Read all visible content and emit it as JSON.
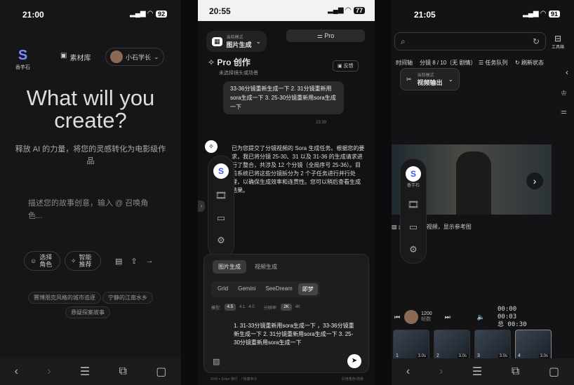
{
  "phone1": {
    "time": "21:00",
    "battery": "92",
    "logo_text": "香芋石",
    "library": "素材库",
    "user": "小石学长",
    "headline": "What will you create?",
    "tagline": "释放 AI 的力量，将您的灵感转化为电影级作品",
    "prompt_placeholder": "描述您的故事创意，输入 @ 召唤角色...",
    "role_btn": "选择角色",
    "smart_btn": "智能推荐",
    "chips": [
      "赛博朋克风格的城市追逐",
      "宁静的江南水乡",
      "悬疑探案故事"
    ]
  },
  "phone2": {
    "time": "20:55",
    "battery": "77",
    "mode_label": "当前模式",
    "mode_value": "图片生成",
    "pro_tab": "Pro",
    "title": "Pro 创作",
    "subtitle": "未选择镜头或场景",
    "feedback": "反馈",
    "user_msg": "33-36分镜重新生成一下 2. 31分镜重新用sora生成一下 3. 25-30分镜重新用sora生成一下",
    "msg_time": "23:39",
    "bot_msg": "已为您提交了分镜视频的 Sora 生成任务。根据您的要求，我已将分镜 25-30、31 以及 31-36 的生成请求进行了整合，共涉及 12 个分镜（全局序号 25-36）。目前系统已将这些分镜拆分为 2 个子任务进行并行处理，以确保生成效率和连贯性。您可以稍后查看生成结果。",
    "tab_img": "图片生成",
    "tab_vid": "视频生成",
    "models": [
      "Grid",
      "Gemini",
      "SeeDream",
      "即梦"
    ],
    "version_label": "模型:",
    "versions": [
      "4.5",
      "4.1",
      "4.0"
    ],
    "res_label": "分辨率:",
    "res": [
      "2K",
      "4K"
    ],
    "input_text": "1. 31-33分镜重新用sora生成一下 ，33-36分镜重新生成一下 2. 31分镜重新用sora生成一下 3. 25-30分镜重新用sora生成一下",
    "footer_hint": "Shift + Enter 换行 · / 快捷命令",
    "footer_right": "引用角色/场景"
  },
  "phone3": {
    "time": "21:05",
    "battery": "91",
    "toolbox": "工具箱",
    "timeline": "时间轴",
    "shot_info": "分镜 8 / 10（无 剧情）",
    "task_queue": "任务队列",
    "refresh": "刷新状态",
    "mode_label": "当前模式",
    "mode_value": "视频输出",
    "no_video": "此分镜暂无视频，显示参考图",
    "logo_text": "香芋石",
    "avatar_label": "1200",
    "avatar_sub": "帧数",
    "time_cur": "00:00",
    "time_mid": "00:03",
    "time_total": "总 00:30",
    "thumbs": [
      {
        "n": "1",
        "d": "3.0s"
      },
      {
        "n": "2",
        "d": "3.0s"
      },
      {
        "n": "3",
        "d": "3.0s"
      },
      {
        "n": "4",
        "d": "3.0s"
      }
    ]
  }
}
